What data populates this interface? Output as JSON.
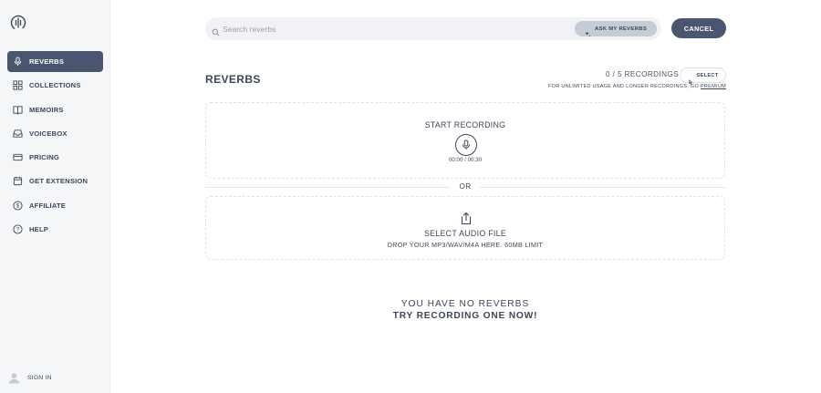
{
  "sidebar": {
    "logo_icon": "waveform-logo-icon",
    "items": [
      {
        "label": "REVERBS",
        "icon": "microphone-icon",
        "active": true
      },
      {
        "label": "COLLECTIONS",
        "icon": "grid-icon",
        "active": false
      },
      {
        "label": "MEMOIRS",
        "icon": "book-icon",
        "active": false
      },
      {
        "label": "VOICEBOX",
        "icon": "inbox-icon",
        "active": false
      },
      {
        "label": "PRICING",
        "icon": "credit-card-icon",
        "active": false
      },
      {
        "label": "GET EXTENSION",
        "icon": "calendar-icon",
        "active": false
      },
      {
        "label": "AFFILIATE",
        "icon": "dollar-icon",
        "active": false
      },
      {
        "label": "HELP",
        "icon": "help-circle-icon",
        "active": false
      }
    ],
    "signin_label": "SIGN IN"
  },
  "search": {
    "placeholder": "Search reverbs",
    "value": "",
    "ask_label": "ASK MY REVERBS"
  },
  "toolbar": {
    "cancel_label": "CANCEL"
  },
  "main": {
    "title": "REVERBS",
    "count": "0 / 5 RECORDINGS",
    "select_label": "SELECT",
    "premium_note": "FOR UNLIMITED USAGE AND LONGER RECORDINGS, GO",
    "premium_link": "PREMIUM",
    "record": {
      "title": "START RECORDING",
      "timer": "00:00 / 00:30"
    },
    "or_label": "OR",
    "upload": {
      "title": "SELECT AUDIO FILE",
      "subtitle": "DROP YOUR MP3/WAV/M4A HERE. 60MB LIMIT"
    },
    "empty": {
      "line1": "YOU HAVE NO REVERBS",
      "line2": "TRY RECORDING ONE NOW!"
    }
  },
  "colors": {
    "accent": "#4a5670",
    "sidebar_bg": "#f5f6f8",
    "text": "#3d4658"
  }
}
